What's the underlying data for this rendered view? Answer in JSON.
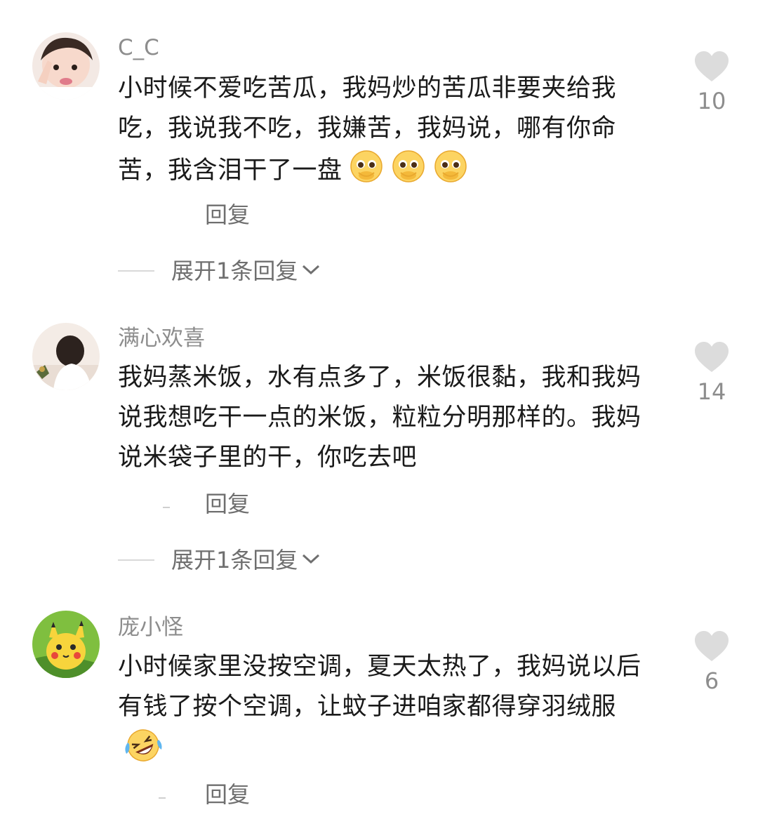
{
  "comments": [
    {
      "username": "C_C",
      "text": "小时候不爱吃苦瓜，我妈炒的苦瓜非要夹给我吃，我说我不吃，我嫌苦，我妈说，哪有你命苦，我含泪干了一盘",
      "emojis": [
        "pleading-face-icon",
        "pleading-face-icon",
        "pleading-face-icon"
      ],
      "reply_label": "回复",
      "expand_label": "展开1条回复",
      "likes": "10"
    },
    {
      "username": "满心欢喜",
      "text": "我妈蒸米饭，水有点多了，米饭很黏，我和我妈说我想吃干一点的米饭，粒粒分明那样的。我妈说米袋子里的干，你吃去吧",
      "emojis": [],
      "reply_label": "回复",
      "expand_label": "展开1条回复",
      "likes": "14"
    },
    {
      "username": "庞小怪",
      "text": "小时候家里没按空调，夏天太热了，我妈说以后有钱了按个空调，让蚊子进咱家都得穿羽绒服",
      "emojis": [
        "rolling-laughing-face-icon"
      ],
      "reply_label": "回复",
      "likes": "6"
    }
  ],
  "colors": {
    "text": "#1a1a1a",
    "muted": "#8d8d8d",
    "heart": "#dcdcdc",
    "background": "#ffffff"
  }
}
